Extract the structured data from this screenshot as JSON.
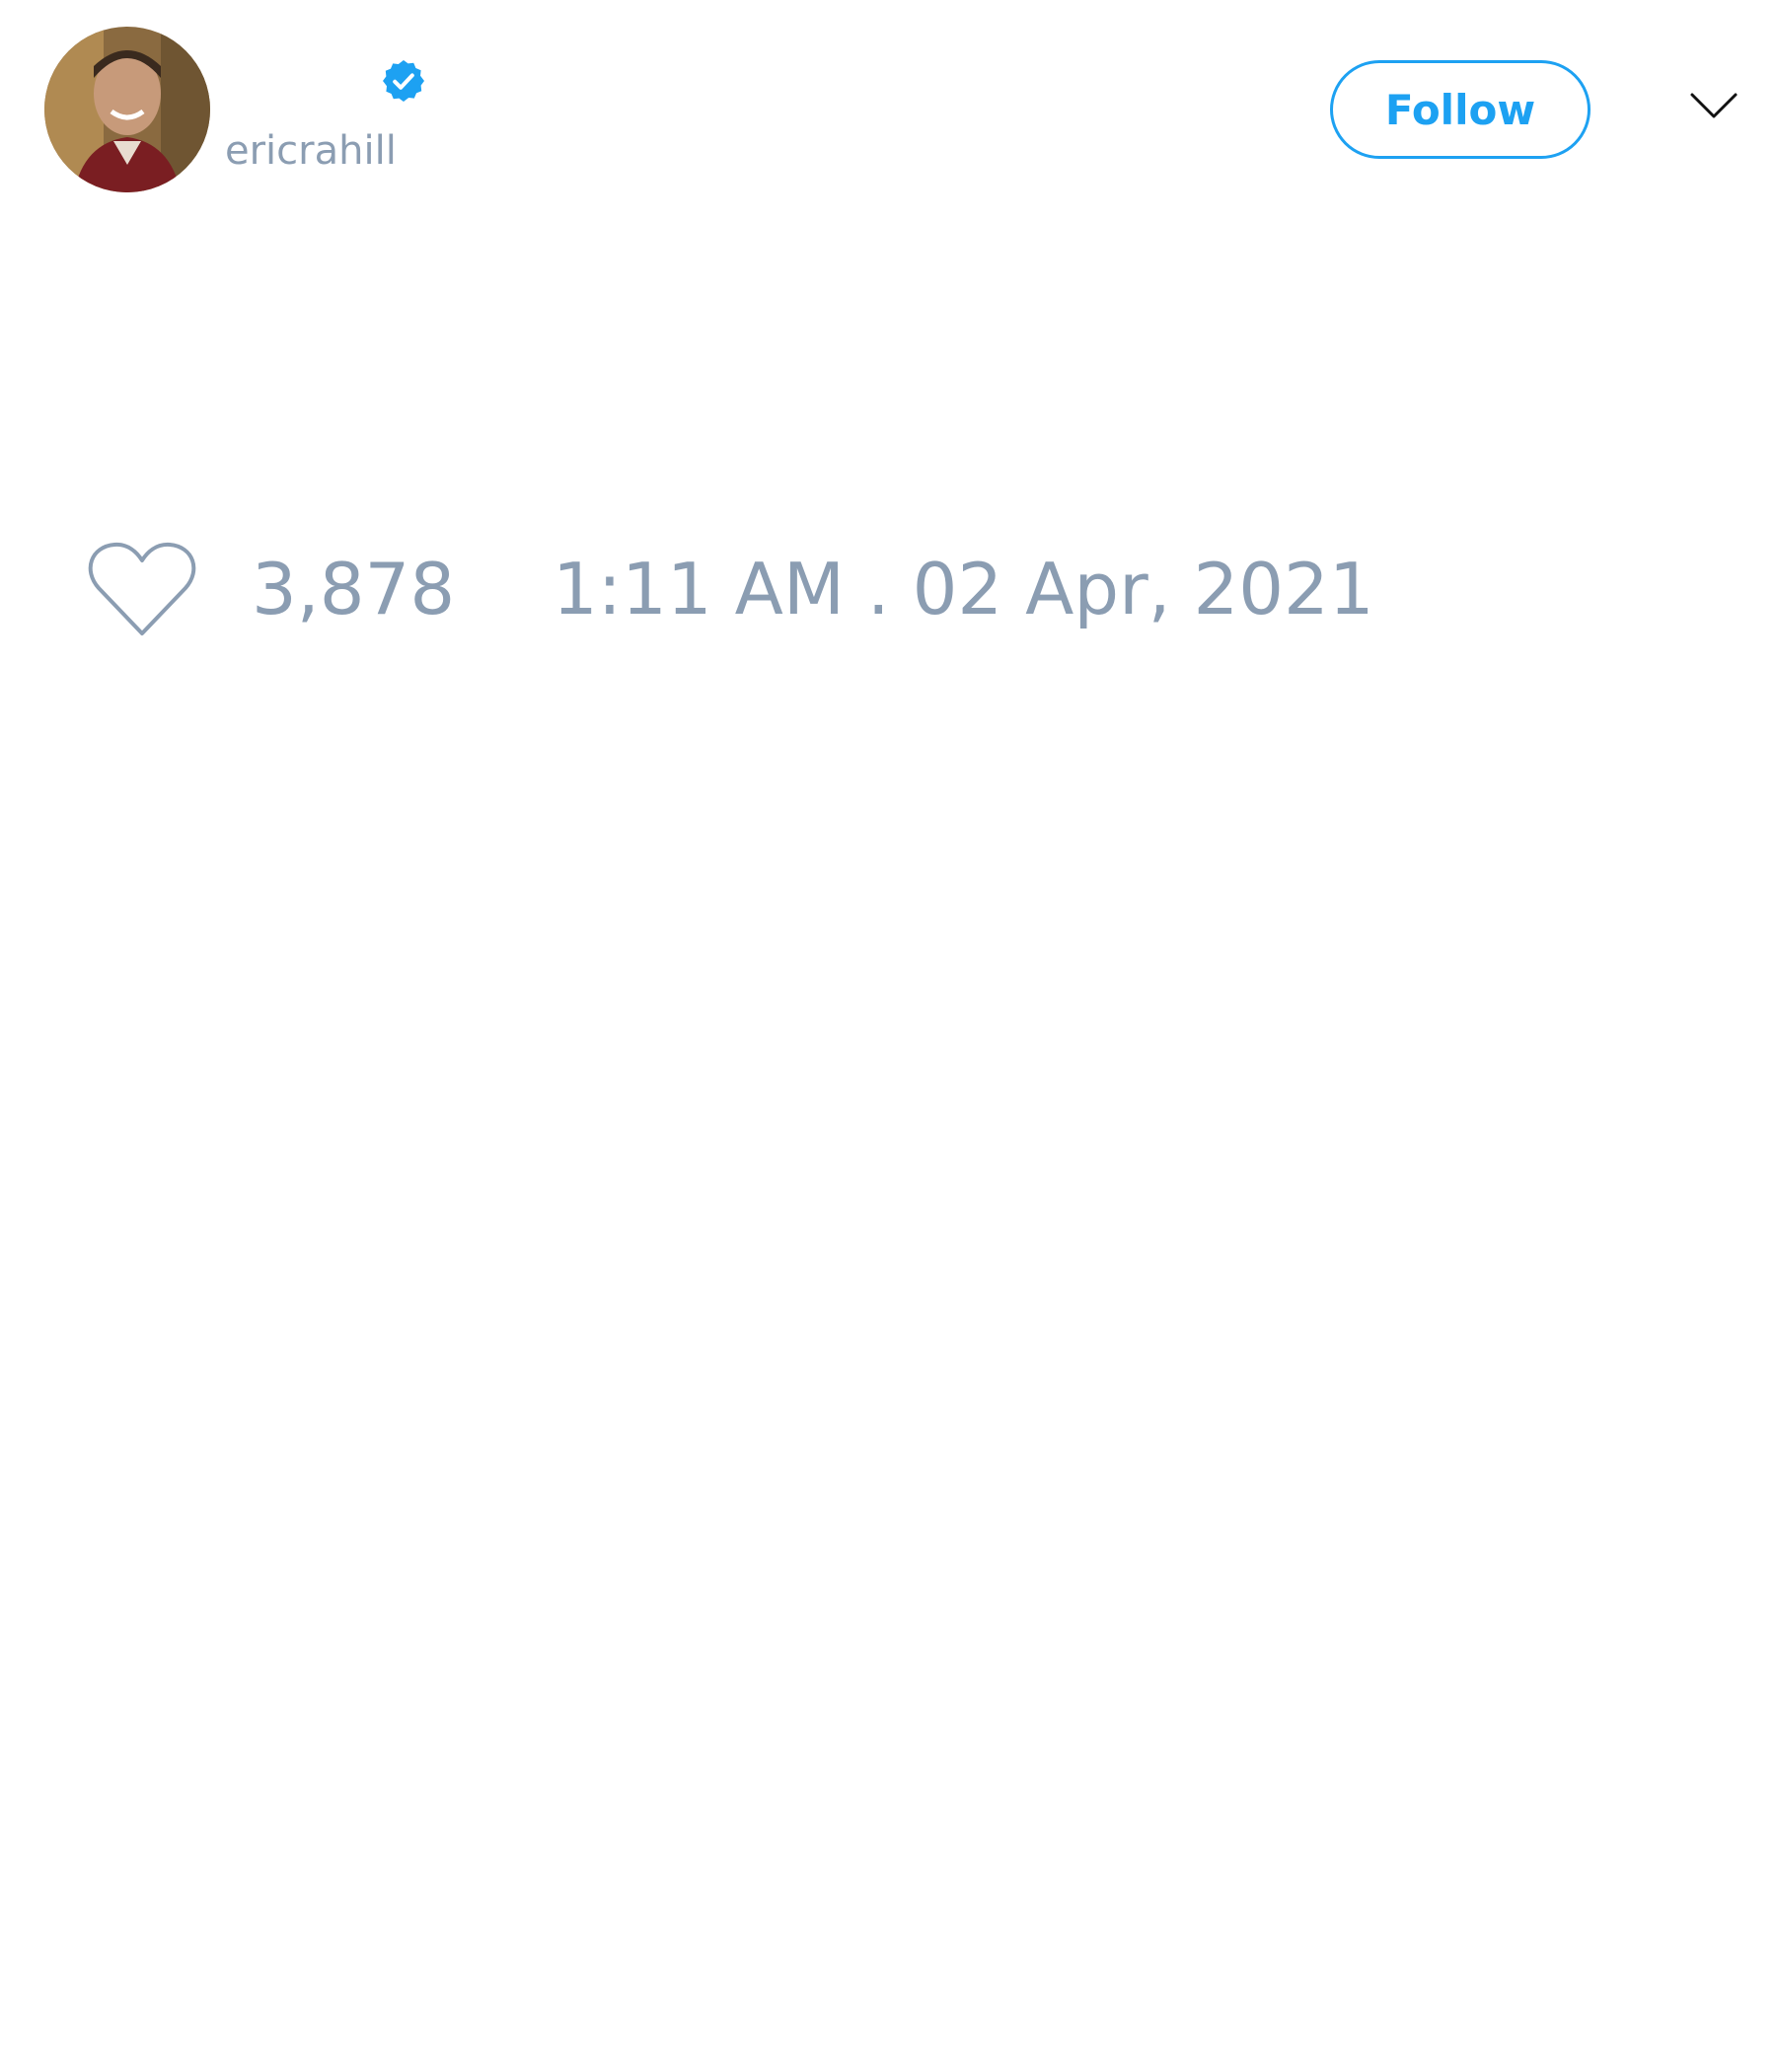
{
  "tweet": {
    "author": {
      "handle": "ericrahill",
      "verified": true
    },
    "follow_button": {
      "label": "Follow"
    },
    "likes": "3,878",
    "timestamp": "1:11 AM . 02 Apr, 2021"
  },
  "icons": {
    "avatar": "avatar-photo",
    "verified": "verified-badge-icon",
    "menu": "chevron-down-icon",
    "like": "heart-outline-icon"
  },
  "colors": {
    "accent": "#1da1f2",
    "muted_text": "#8b9db2",
    "background": "#ffffff"
  }
}
